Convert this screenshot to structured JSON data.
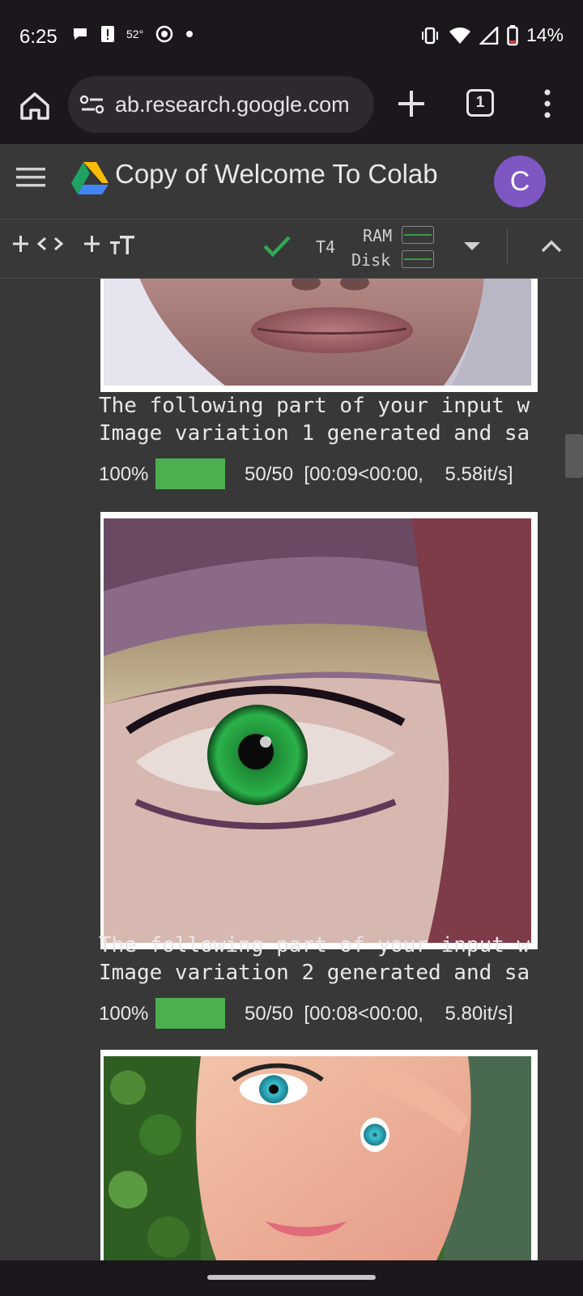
{
  "status_bar": {
    "time": "6:25",
    "temperature": "52°",
    "battery": "14%",
    "icons_left": [
      "chat-bubble-icon",
      "alert-icon",
      "weather-icon",
      "screen-record-icon",
      "dot-icon"
    ],
    "icons_right": [
      "vibrate-icon",
      "wifi-icon",
      "signal-icon",
      "battery-low-icon"
    ]
  },
  "browser": {
    "url": "ab.research.google.com",
    "tab_count": "1"
  },
  "colab": {
    "title": "Copy of Welcome To Colab",
    "avatar_letter": "C",
    "toolbar": {
      "add_code_label": "+ <>",
      "add_text_label": "+ TT",
      "runtime": "T4",
      "ram_label": "RAM",
      "disk_label": "Disk",
      "connected_color": "#34a853"
    }
  },
  "output": {
    "truncated_lines": [
      "The following part of your input w",
      "Image variation 1 generated and sa",
      "The following part of your input w",
      "Image variation 2 generated and sa"
    ],
    "progress": [
      {
        "percent": "100%",
        "fraction": 1.0,
        "stats": "50/50  [00:09<00:00,    5.58it/s]"
      },
      {
        "percent": "100%",
        "fraction": 1.0,
        "stats": "50/50  [00:08<00:00,    5.80it/s]"
      }
    ],
    "images": [
      "generated-face-lips-image",
      "generated-green-eye-image",
      "generated-curly-hair-face-image"
    ]
  }
}
